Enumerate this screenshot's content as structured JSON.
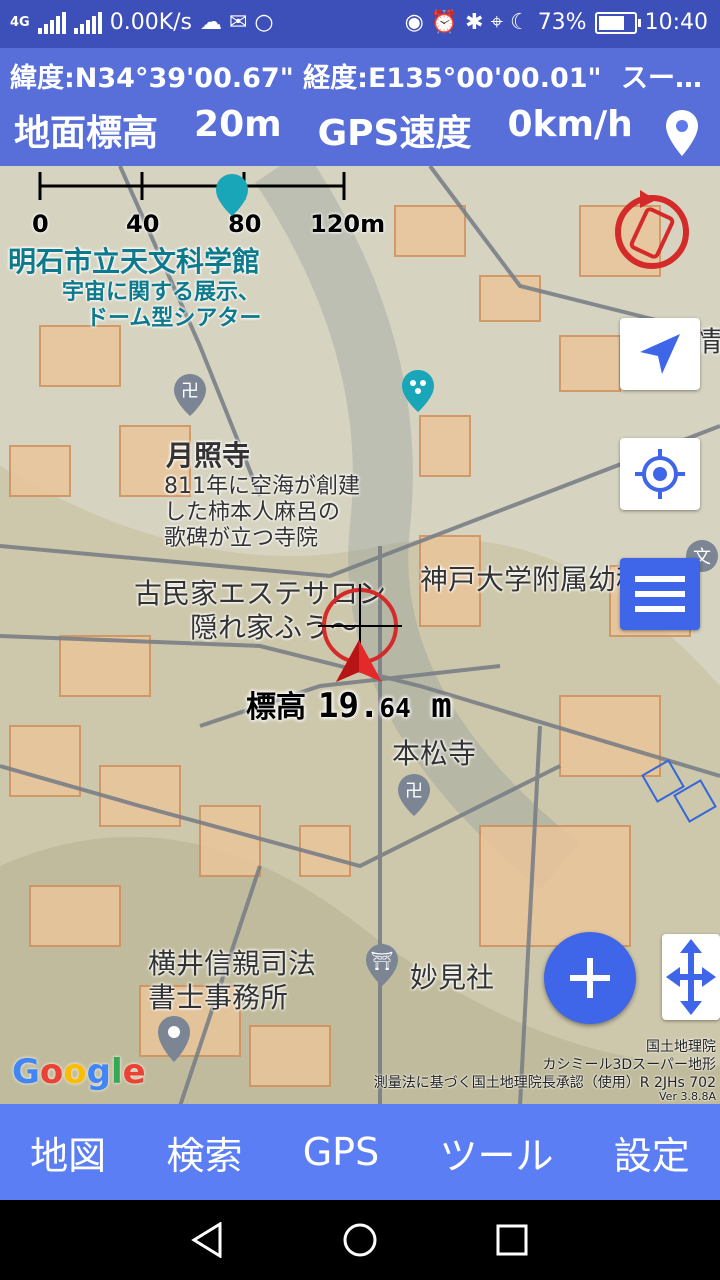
{
  "status_bar": {
    "network": "4G",
    "speed": "0.00K/s",
    "battery": "73%",
    "time": "10:40"
  },
  "info": {
    "coords": "緯度:N34°39'00.67\"   経度:E135°00'00.01\"",
    "coords_more": "スー…",
    "altitude_label": "地面標高",
    "altitude_value": "20m",
    "gps_label": "GPS速度",
    "gps_value": "0km/h"
  },
  "scale": {
    "t0": "0",
    "t1": "40",
    "t2": "80",
    "t3": "120m"
  },
  "map_labels": {
    "planetarium": "明石市立天文科学館",
    "planetarium_desc1": "宇宙に関する展示、",
    "planetarium_desc2": "ドーム型シアター",
    "temple1": "月照寺",
    "temple1_desc1": "811年に空海が創建",
    "temple1_desc2": "した柿本人麻呂の",
    "temple1_desc3": "歌碑が立つ寺院",
    "salon1": "古民家エステサロン",
    "salon2": "隠れ家ふう〜",
    "school": "神戸大学附属幼稚",
    "temple2": "本松寺",
    "office1": "横井信親司法",
    "office2": "書士事務所",
    "shrine": "妙見社",
    "side_char": "情",
    "school_icon": "文"
  },
  "elevation": {
    "label": "標高",
    "integer": "19.",
    "decimal": "64",
    "unit": "m"
  },
  "attribution": {
    "line1": "国土地理院",
    "line2": "カシミール3Dスーパー地形",
    "line3": "測量法に基づく国土地理院長承認（使用）R 2JHs 702",
    "version": "Ver 3.8.8A"
  },
  "google": "Google",
  "bottom_nav": [
    "地図",
    "検索",
    "GPS",
    "ツール",
    "設定"
  ],
  "colors": {
    "accent": "#3f65e8",
    "nav": "#5b7ef5",
    "status": "#3d4fb8"
  }
}
